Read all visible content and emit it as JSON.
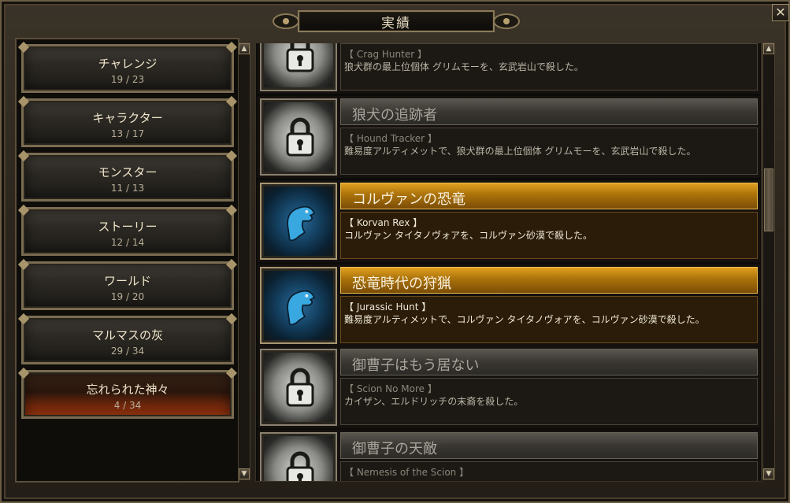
{
  "window": {
    "title": "実績",
    "close_label": "✕"
  },
  "categories": [
    {
      "name": "チャレンジ",
      "count": "19 / 23",
      "active": false
    },
    {
      "name": "キャラクター",
      "count": "13 / 17",
      "active": false
    },
    {
      "name": "モンスター",
      "count": "11 / 13",
      "active": false
    },
    {
      "name": "ストーリー",
      "count": "12 / 14",
      "active": false
    },
    {
      "name": "ワールド",
      "count": "19 / 20",
      "active": false
    },
    {
      "name": "マルマスの灰",
      "count": "29 / 34",
      "active": false
    },
    {
      "name": "忘れられた神々",
      "count": "4 / 34",
      "active": true
    }
  ],
  "achievements": [
    {
      "title": "",
      "tag": "【 Crag Hunter 】",
      "desc": "狼犬群の最上位個体 グリムモーを、玄武岩山で殺した。",
      "unlocked": false,
      "icon": "lock-icon"
    },
    {
      "title": "狼犬の追跡者",
      "tag": "【 Hound Tracker 】",
      "desc": "難易度アルティメットで、狼犬群の最上位個体 グリムモーを、玄武岩山で殺した。",
      "unlocked": false,
      "icon": "lock-icon"
    },
    {
      "title": "コルヴァンの恐竜",
      "tag": "【 Korvan Rex 】",
      "desc": "コルヴァン タイタノヴォアを、コルヴァン砂漠で殺した。",
      "unlocked": true,
      "icon": "dinosaur-icon"
    },
    {
      "title": "恐竜時代の狩猟",
      "tag": "【 Jurassic Hunt 】",
      "desc": "難易度アルティメットで、コルヴァン タイタノヴォアを、コルヴァン砂漠で殺した。",
      "unlocked": true,
      "icon": "dinosaur-icon"
    },
    {
      "title": "御曹子はもう居ない",
      "tag": "【 Scion No More 】",
      "desc": "カイザン、エルドリッチの末裔を殺した。",
      "unlocked": false,
      "icon": "lock-icon"
    },
    {
      "title": "御曹子の天敵",
      "tag": "【 Nemesis of the Scion 】",
      "desc": "",
      "unlocked": false,
      "icon": "lock-icon"
    }
  ],
  "scrollbar": {
    "up": "▲",
    "down": "▼"
  },
  "colors": {
    "gold": "#e0a020",
    "frame": "#8a7a58",
    "active_category": "#c84a14"
  }
}
